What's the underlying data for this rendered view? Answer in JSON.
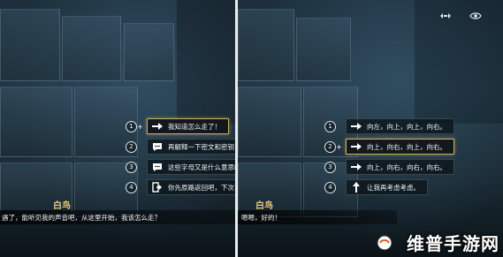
{
  "left": {
    "choices": [
      {
        "number": "1",
        "icon": "arrow-right-icon",
        "label": "我知道怎么走了！",
        "selected": true
      },
      {
        "number": "2",
        "icon": "speech-bubble-icon",
        "label": "再解释一下密文和密钥！",
        "selected": false
      },
      {
        "number": "3",
        "icon": "speech-bubble-icon",
        "label": "这些字母又是什么意思呢？",
        "selected": false
      },
      {
        "number": "4",
        "icon": "exit-door-icon",
        "label": "你先原路返回吧，下次再来",
        "selected": false
      }
    ],
    "speaker": "白鸟",
    "dialogue": "遇了，能听见我的声音吧，从这里开始，我该怎么走？"
  },
  "right": {
    "choices": [
      {
        "number": "1",
        "icon": "arrow-right-icon",
        "label": "向左，向上，向上，向右。",
        "selected": false
      },
      {
        "number": "2",
        "icon": "arrow-right-icon",
        "label": "向上，向右，向上，向右。",
        "selected": true
      },
      {
        "number": "3",
        "icon": "arrow-right-icon",
        "label": "向上，向右，向右，向右。",
        "selected": false
      },
      {
        "number": "4",
        "icon": "arrow-up-icon",
        "label": "让我再考虑考虑。",
        "selected": false
      }
    ],
    "speaker": "白鸟",
    "dialogue": "嗯嗯，好的！"
  },
  "hud": {
    "icons": [
      "hide-ui-icon",
      "eye-icon"
    ]
  },
  "watermark": "维普手游网",
  "colors": {
    "selected_border": "#c9ad62",
    "speaker": "#e8c77a"
  }
}
